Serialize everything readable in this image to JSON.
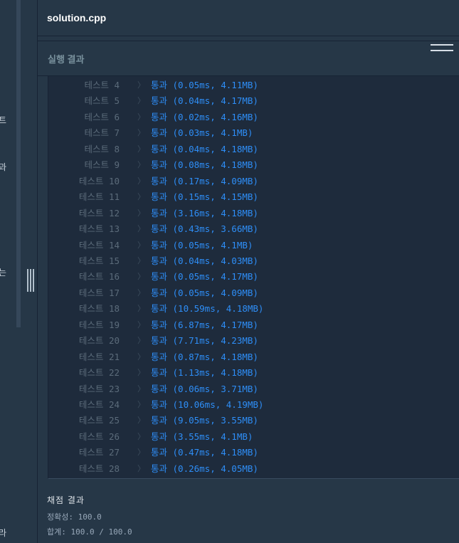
{
  "left_pane": {
    "fragments": [
      "트",
      "과",
      "는",
      "라"
    ]
  },
  "editor": {
    "file_name": "solution.cpp"
  },
  "result_panel": {
    "title": "실행 결과",
    "tests": [
      {
        "name": "테스트 4",
        "result": "통과 (0.05ms, 4.11MB)"
      },
      {
        "name": "테스트 5",
        "result": "통과 (0.04ms, 4.17MB)"
      },
      {
        "name": "테스트 6",
        "result": "통과 (0.02ms, 4.16MB)"
      },
      {
        "name": "테스트 7",
        "result": "통과 (0.03ms, 4.1MB)"
      },
      {
        "name": "테스트 8",
        "result": "통과 (0.04ms, 4.18MB)"
      },
      {
        "name": "테스트 9",
        "result": "통과 (0.08ms, 4.18MB)"
      },
      {
        "name": "테스트 10",
        "result": "통과 (0.17ms, 4.09MB)"
      },
      {
        "name": "테스트 11",
        "result": "통과 (0.15ms, 4.15MB)"
      },
      {
        "name": "테스트 12",
        "result": "통과 (3.16ms, 4.18MB)"
      },
      {
        "name": "테스트 13",
        "result": "통과 (0.43ms, 3.66MB)"
      },
      {
        "name": "테스트 14",
        "result": "통과 (0.05ms, 4.1MB)"
      },
      {
        "name": "테스트 15",
        "result": "통과 (0.04ms, 4.03MB)"
      },
      {
        "name": "테스트 16",
        "result": "통과 (0.05ms, 4.17MB)"
      },
      {
        "name": "테스트 17",
        "result": "통과 (0.05ms, 4.09MB)"
      },
      {
        "name": "테스트 18",
        "result": "통과 (10.59ms, 4.18MB)"
      },
      {
        "name": "테스트 19",
        "result": "통과 (6.87ms, 4.17MB)"
      },
      {
        "name": "테스트 20",
        "result": "통과 (7.71ms, 4.23MB)"
      },
      {
        "name": "테스트 21",
        "result": "통과 (0.87ms, 4.18MB)"
      },
      {
        "name": "테스트 22",
        "result": "통과 (1.13ms, 4.18MB)"
      },
      {
        "name": "테스트 23",
        "result": "통과 (0.06ms, 3.71MB)"
      },
      {
        "name": "테스트 24",
        "result": "통과 (10.06ms, 4.19MB)"
      },
      {
        "name": "테스트 25",
        "result": "통과 (9.05ms, 3.55MB)"
      },
      {
        "name": "테스트 26",
        "result": "통과 (3.55ms, 4.1MB)"
      },
      {
        "name": "테스트 27",
        "result": "통과 (0.47ms, 4.18MB)"
      },
      {
        "name": "테스트 28",
        "result": "통과 (0.26ms, 4.05MB)"
      }
    ],
    "separator_glyph": "〉"
  },
  "grading": {
    "title": "채점 결과",
    "accuracy": "정확성: 100.0",
    "total": "합계: 100.0 / 100.0"
  },
  "colors": {
    "background": "#263747",
    "result_background": "#1e2b3c",
    "pass": "#2e8ef7",
    "test_name": "#5b6b7a"
  }
}
